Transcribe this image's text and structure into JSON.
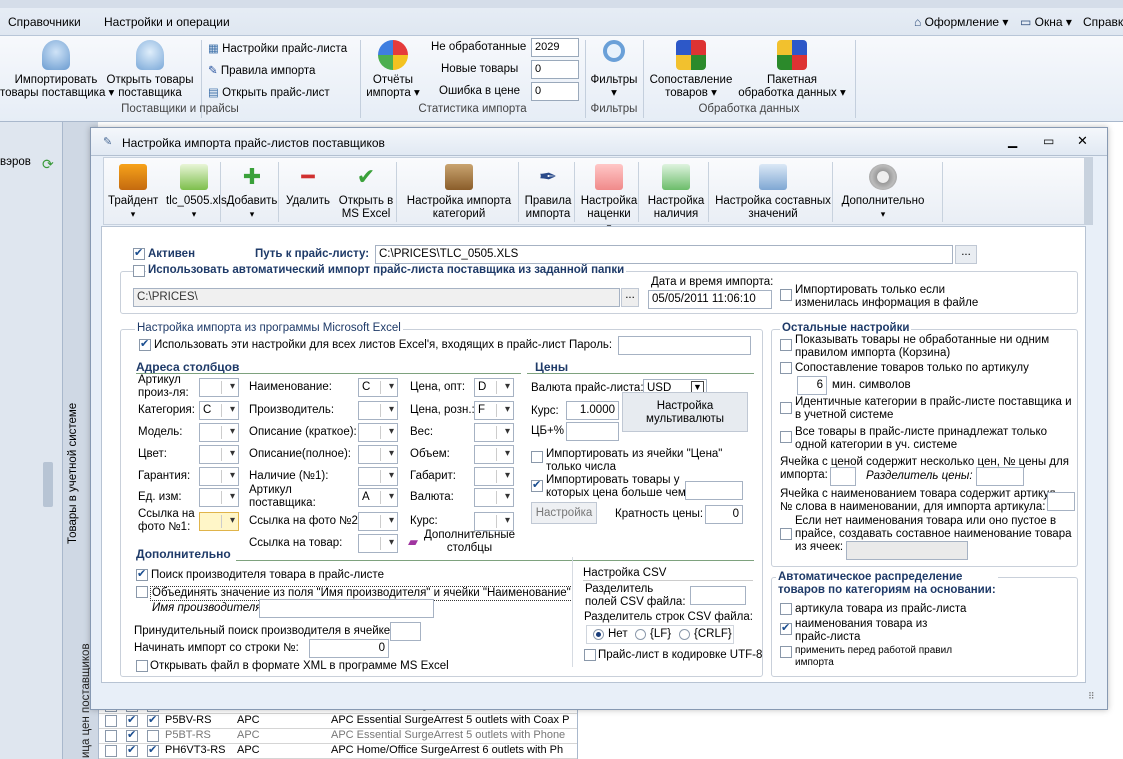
{
  "topbar": {
    "menu_left": [
      "Справочники",
      "Настройки и операции"
    ],
    "menu_right": [
      "Оформление",
      "Окна",
      "Справка"
    ],
    "truncated_title": "… Настройки и операции …"
  },
  "ribbon": {
    "import_btn": [
      "Импортировать",
      "товары поставщика"
    ],
    "open_goods_btn": [
      "Открыть товары",
      "поставщика"
    ],
    "small_links": [
      "Настройки прайс-листа",
      "Правила импорта",
      "Открыть прайс-лист"
    ],
    "group_suppliers": "Поставщики и прайсы",
    "reports_btn": [
      "Отчёты",
      "импорта"
    ],
    "stats": [
      {
        "label": "Не обработанные",
        "value": "2029"
      },
      {
        "label": "Новые товары",
        "value": "0"
      },
      {
        "label": "Ошибка в цене",
        "value": "0"
      }
    ],
    "group_stats": "Статистика импорта",
    "filters_btn": "Фильтры",
    "group_filters": "Фильтры",
    "match_btn": [
      "Сопоставление",
      "товаров"
    ],
    "batch_btn": [
      "Пакетная",
      "обработка данных"
    ],
    "group_data": "Обработка данных"
  },
  "sidebar": {
    "left_text": "вэров",
    "vertical_1": "Товары в учетной системе",
    "vertical_2": "ица цен поставщиков"
  },
  "dialog": {
    "title": "Настройка импорта прайс-листов поставщиков",
    "toolbar": [
      {
        "label": [
          "Трайдент"
        ],
        "icon": "truck-icon",
        "arrow": true
      },
      {
        "label": [
          "tlc_0505.xls"
        ],
        "icon": "xls-icon",
        "arrow": true
      },
      {
        "label": [
          "Добавить"
        ],
        "icon": "plus-icon",
        "arrow": true
      },
      {
        "label": [
          "Удалить"
        ],
        "icon": "minus-icon",
        "arrow": false
      },
      {
        "label": [
          "Открыть в",
          "MS Excel"
        ],
        "icon": "check-icon",
        "arrow": false
      },
      {
        "label": [
          "Настройка импорта",
          "категорий"
        ],
        "icon": "category-icon",
        "arrow": false
      },
      {
        "label": [
          "Правила",
          "импорта"
        ],
        "icon": "pen-icon",
        "arrow": false
      },
      {
        "label": [
          "Настройка",
          "наценки"
        ],
        "icon": "piggy-icon",
        "arrow": true
      },
      {
        "label": [
          "Настройка",
          "наличия"
        ],
        "icon": "cart-icon",
        "arrow": false
      },
      {
        "label": [
          "Настройка составных",
          "значений"
        ],
        "icon": "laptop-icon",
        "arrow": false
      },
      {
        "label": [
          "Дополнительно"
        ],
        "icon": "gear-icon",
        "arrow": true
      }
    ],
    "active_label": "Активен",
    "path_label": "Путь к прайс-листу:",
    "path_value": "C:\\PRICES\\TLC_0505.XLS",
    "auto_import_label": "Использовать автоматический импорт прайс-листа поставщика из заданной папки",
    "auto_folder": "C:\\PRICES\\",
    "date_label": "Дата и время импорта:",
    "date_value": "05/05/2011 11:06:10",
    "import_changed_label": [
      "Импортировать только если",
      "изменилась информация в файле"
    ],
    "excel_section": "Настройка импорта из программы Microsoft Excel",
    "all_sheets_label": "Использовать эти настройки для всех листов Excel'я, входящих в прайс-лист",
    "password_label": "Пароль:",
    "columns_header": "Адреса столбцов",
    "prices_header": "Цены",
    "col1": [
      {
        "label": "Артикул\nпроиз-ля:",
        "value": ""
      },
      {
        "label": "Категория:",
        "value": "C"
      },
      {
        "label": "Модель:",
        "value": ""
      },
      {
        "label": "Цвет:",
        "value": ""
      },
      {
        "label": "Гарантия:",
        "value": ""
      },
      {
        "label": "Ед. изм:",
        "value": ""
      },
      {
        "label": "Ссылка на\nфото №1:",
        "value": ""
      }
    ],
    "col2": [
      {
        "label": "Наименование:",
        "value": "C"
      },
      {
        "label": "Производитель:",
        "value": ""
      },
      {
        "label": "Описание (краткое):",
        "value": ""
      },
      {
        "label": "Описание(полное):",
        "value": ""
      },
      {
        "label": "Наличие (№1):",
        "value": ""
      },
      {
        "label": "Артикул\nпоставщика:",
        "value": "A"
      },
      {
        "label": "Ссылка на фото №2:",
        "value": ""
      },
      {
        "label": "Ссылка на товар:",
        "value": ""
      }
    ],
    "col3": [
      {
        "label": "Цена, опт:",
        "value": "D"
      },
      {
        "label": "Цена, розн.:",
        "value": "F"
      },
      {
        "label": "Вес:",
        "value": ""
      },
      {
        "label": "Объем:",
        "value": ""
      },
      {
        "label": "Габарит:",
        "value": ""
      },
      {
        "label": "Валюта:",
        "value": ""
      },
      {
        "label": "Курс:",
        "value": ""
      }
    ],
    "extra_columns": [
      "Дополнительные",
      "столбцы"
    ],
    "currency_label": "Валюта прайс-листа:",
    "currency_value": "USD",
    "rate_label": "Курс:",
    "rate_value": "1.0000",
    "cb_label": "ЦБ+%",
    "multicurrency_btn": [
      "Настройка",
      "мультивалюты"
    ],
    "price_cell_label": [
      "Импортировать из ячейки \"Цена\"",
      "только числа"
    ],
    "price_greater_label": [
      "Импортировать товары у",
      "которых цена больше чем:"
    ],
    "setup_btn": "Настройка",
    "multiplicity_label": "Кратность цены:",
    "multiplicity_value": "0",
    "additional_header": "Дополнительно",
    "search_manufacturer": "Поиск производителя товара в прайс-листе",
    "merge_label": "Объединять значение из поля \"Имя производителя\" и ячейки \"Наименование\"",
    "manufacturer_name_label": "Имя производителя:",
    "forced_search_label": "Принудительный поиск производителя в ячейке:",
    "start_row_label": "Начинать импорт со строки №:",
    "start_row_value": "0",
    "open_xml_label": "Открывать файл в формате XML в программе MS Excel",
    "csv_header": "Настройка CSV",
    "csv_field_sep": [
      "Разделитель",
      "полей CSV файла:"
    ],
    "csv_row_sep": "Разделитель строк CSV файла:",
    "csv_options": [
      "Нет",
      "{LF}",
      "{CRLF}"
    ],
    "utf8_label": "Прайс-лист в кодировке UTF-8",
    "other_header": "Остальные настройки",
    "other": {
      "basket": [
        "Показывать товары не обработанные ни одним",
        "правилом импорта (Корзина)"
      ],
      "article_match": "Сопоставление товаров только по артикулу",
      "min_chars_value": "6",
      "min_chars_label": "мин. символов",
      "same_categories": [
        "Идентичные категории в прайс-листе поставщика и",
        "в учетной системе"
      ],
      "one_category": [
        "Все товары в прайс-листе принадлежат только",
        "одной категории в уч. системе"
      ],
      "multi_price": [
        "Ячейка с ценой содержит несколько цен, № цены для",
        "импорта:"
      ],
      "price_separator": "Разделитель цены:",
      "name_article": [
        "Ячейка с наименованием товара содержит артикул,",
        "№ слова в наименовании, для импорта артикула:"
      ],
      "composite": [
        "Если нет наименования товара или оно пустое в",
        "прайсе, создавать составное наименование товара",
        "из ячеек:"
      ]
    },
    "auto_dist_header": [
      "Автоматическое распределение",
      "товаров по категориям на основании:"
    ],
    "auto_dist": {
      "by_article": "артикула товара из прайс-листа",
      "by_name": [
        "наименования товара из",
        "прайс-листа"
      ],
      "apply_rules": [
        "применить перед работой правил",
        "импорта"
      ]
    }
  },
  "grid_rows": [
    {
      "checks": [
        false,
        false,
        true
      ],
      "code": "P5B-RS",
      "brand": "APC",
      "name": "APC Essential SurgeArrest 5 outlets 230V Russia",
      "grey": false
    },
    {
      "checks": [
        false,
        true,
        true
      ],
      "code": "P5BV-RS",
      "brand": "APC",
      "name": "APC Essential SurgeArrest 5 outlets with Coax P",
      "grey": false
    },
    {
      "checks": [
        false,
        true,
        false
      ],
      "code": "P5BT-RS",
      "brand": "APC",
      "name": "APC Essential SurgeArrest 5 outlets with Phone",
      "grey": true
    },
    {
      "checks": [
        false,
        true,
        true
      ],
      "code": "PH6VT3-RS",
      "brand": "APC",
      "name": "APC Home/Office SurgeArrest 6 outlets with Ph",
      "grey": false
    }
  ]
}
